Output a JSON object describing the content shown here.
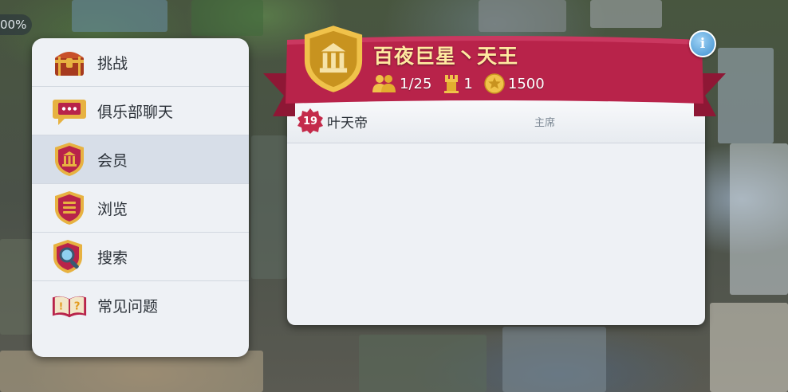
{
  "status": {
    "percent_fragment": "00%"
  },
  "menu": {
    "items": [
      {
        "label": "挑战",
        "icon": "treasure-chest-icon",
        "active": false
      },
      {
        "label": "俱乐部聊天",
        "icon": "chat-bubble-icon",
        "active": false
      },
      {
        "label": "会员",
        "icon": "club-shield-icon",
        "active": true
      },
      {
        "label": "浏览",
        "icon": "list-shield-icon",
        "active": false
      },
      {
        "label": "搜索",
        "icon": "magnifier-shield-icon",
        "active": false
      },
      {
        "label": "常见问题",
        "icon": "faq-book-icon",
        "active": false
      }
    ]
  },
  "club": {
    "name": "百夜巨星丶天王",
    "members": "1/25",
    "level": "1",
    "points": "1500",
    "emblem": "club-shield-icon"
  },
  "members": [
    {
      "level": "19",
      "name": "叶天帝",
      "role": "主席"
    }
  ],
  "colors": {
    "banner": "#b8234a",
    "gold": "#e6b33a",
    "menu_bg": "#eef1f5",
    "active_row": "#d7dee8",
    "info_button": "#3d8fcf"
  }
}
